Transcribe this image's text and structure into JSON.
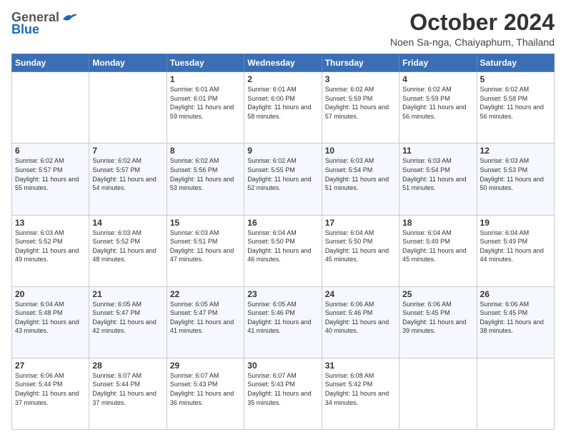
{
  "logo": {
    "general": "General",
    "blue": "Blue"
  },
  "title": "October 2024",
  "location": "Noen Sa-nga, Chaiyaphum, Thailand",
  "days_of_week": [
    "Sunday",
    "Monday",
    "Tuesday",
    "Wednesday",
    "Thursday",
    "Friday",
    "Saturday"
  ],
  "weeks": [
    [
      {
        "day": "",
        "info": ""
      },
      {
        "day": "",
        "info": ""
      },
      {
        "day": "1",
        "info": "Sunrise: 6:01 AM\nSunset: 6:01 PM\nDaylight: 11 hours and 59 minutes."
      },
      {
        "day": "2",
        "info": "Sunrise: 6:01 AM\nSunset: 6:00 PM\nDaylight: 11 hours and 58 minutes."
      },
      {
        "day": "3",
        "info": "Sunrise: 6:02 AM\nSunset: 5:59 PM\nDaylight: 11 hours and 57 minutes."
      },
      {
        "day": "4",
        "info": "Sunrise: 6:02 AM\nSunset: 5:59 PM\nDaylight: 11 hours and 56 minutes."
      },
      {
        "day": "5",
        "info": "Sunrise: 6:02 AM\nSunset: 5:58 PM\nDaylight: 11 hours and 56 minutes."
      }
    ],
    [
      {
        "day": "6",
        "info": "Sunrise: 6:02 AM\nSunset: 5:57 PM\nDaylight: 11 hours and 55 minutes."
      },
      {
        "day": "7",
        "info": "Sunrise: 6:02 AM\nSunset: 5:57 PM\nDaylight: 11 hours and 54 minutes."
      },
      {
        "day": "8",
        "info": "Sunrise: 6:02 AM\nSunset: 5:56 PM\nDaylight: 11 hours and 53 minutes."
      },
      {
        "day": "9",
        "info": "Sunrise: 6:02 AM\nSunset: 5:55 PM\nDaylight: 11 hours and 52 minutes."
      },
      {
        "day": "10",
        "info": "Sunrise: 6:03 AM\nSunset: 5:54 PM\nDaylight: 11 hours and 51 minutes."
      },
      {
        "day": "11",
        "info": "Sunrise: 6:03 AM\nSunset: 5:54 PM\nDaylight: 11 hours and 51 minutes."
      },
      {
        "day": "12",
        "info": "Sunrise: 6:03 AM\nSunset: 5:53 PM\nDaylight: 11 hours and 50 minutes."
      }
    ],
    [
      {
        "day": "13",
        "info": "Sunrise: 6:03 AM\nSunset: 5:52 PM\nDaylight: 11 hours and 49 minutes."
      },
      {
        "day": "14",
        "info": "Sunrise: 6:03 AM\nSunset: 5:52 PM\nDaylight: 11 hours and 48 minutes."
      },
      {
        "day": "15",
        "info": "Sunrise: 6:03 AM\nSunset: 5:51 PM\nDaylight: 11 hours and 47 minutes."
      },
      {
        "day": "16",
        "info": "Sunrise: 6:04 AM\nSunset: 5:50 PM\nDaylight: 11 hours and 46 minutes."
      },
      {
        "day": "17",
        "info": "Sunrise: 6:04 AM\nSunset: 5:50 PM\nDaylight: 11 hours and 45 minutes."
      },
      {
        "day": "18",
        "info": "Sunrise: 6:04 AM\nSunset: 5:49 PM\nDaylight: 11 hours and 45 minutes."
      },
      {
        "day": "19",
        "info": "Sunrise: 6:04 AM\nSunset: 5:49 PM\nDaylight: 11 hours and 44 minutes."
      }
    ],
    [
      {
        "day": "20",
        "info": "Sunrise: 6:04 AM\nSunset: 5:48 PM\nDaylight: 11 hours and 43 minutes."
      },
      {
        "day": "21",
        "info": "Sunrise: 6:05 AM\nSunset: 5:47 PM\nDaylight: 11 hours and 42 minutes."
      },
      {
        "day": "22",
        "info": "Sunrise: 6:05 AM\nSunset: 5:47 PM\nDaylight: 11 hours and 41 minutes."
      },
      {
        "day": "23",
        "info": "Sunrise: 6:05 AM\nSunset: 5:46 PM\nDaylight: 11 hours and 41 minutes."
      },
      {
        "day": "24",
        "info": "Sunrise: 6:06 AM\nSunset: 5:46 PM\nDaylight: 11 hours and 40 minutes."
      },
      {
        "day": "25",
        "info": "Sunrise: 6:06 AM\nSunset: 5:45 PM\nDaylight: 11 hours and 39 minutes."
      },
      {
        "day": "26",
        "info": "Sunrise: 6:06 AM\nSunset: 5:45 PM\nDaylight: 11 hours and 38 minutes."
      }
    ],
    [
      {
        "day": "27",
        "info": "Sunrise: 6:06 AM\nSunset: 5:44 PM\nDaylight: 11 hours and 37 minutes."
      },
      {
        "day": "28",
        "info": "Sunrise: 6:07 AM\nSunset: 5:44 PM\nDaylight: 11 hours and 37 minutes."
      },
      {
        "day": "29",
        "info": "Sunrise: 6:07 AM\nSunset: 5:43 PM\nDaylight: 11 hours and 36 minutes."
      },
      {
        "day": "30",
        "info": "Sunrise: 6:07 AM\nSunset: 5:43 PM\nDaylight: 11 hours and 35 minutes."
      },
      {
        "day": "31",
        "info": "Sunrise: 6:08 AM\nSunset: 5:42 PM\nDaylight: 11 hours and 34 minutes."
      },
      {
        "day": "",
        "info": ""
      },
      {
        "day": "",
        "info": ""
      }
    ]
  ]
}
